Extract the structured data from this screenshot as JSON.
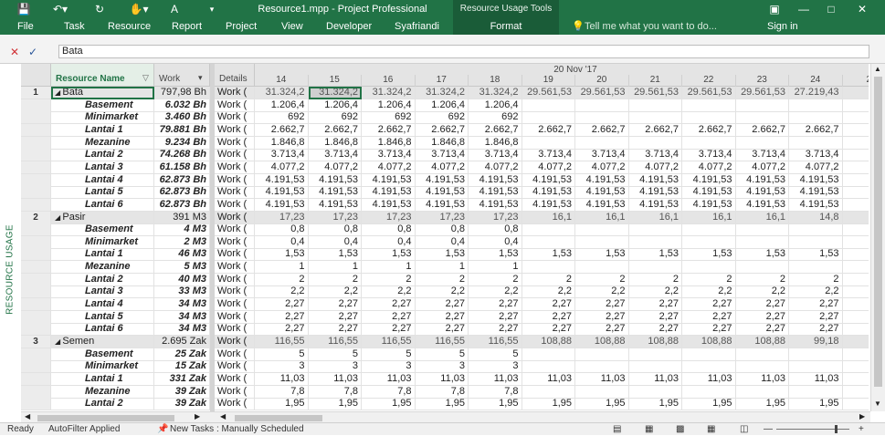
{
  "title": {
    "text": "Resource1.mpp - Project Professional",
    "context_group": "Resource Usage Tools",
    "user": "Sign in"
  },
  "ribbon": {
    "tabs": [
      "File",
      "Task",
      "Resource",
      "Report",
      "Project",
      "View",
      "Developer",
      "Syafriandi"
    ],
    "context_tab": "Format",
    "tell_me": "Tell me what you want to do..."
  },
  "entry": {
    "value": "Bata"
  },
  "view_label": "RESOURCE USAGE",
  "columns": {
    "name": "Resource Name",
    "work": "Work",
    "details": "Details",
    "week": "20 Nov '17",
    "days": [
      "14",
      "15",
      "16",
      "17",
      "18",
      "19",
      "20",
      "21",
      "22",
      "23",
      "24",
      "2"
    ]
  },
  "rows": [
    {
      "id": "1",
      "name": "Bata",
      "work": "797,98 Bh",
      "group": true,
      "d": "Work (",
      "vals": [
        "31.324,2",
        "31.324,2",
        "31.324,2",
        "31.324,2",
        "31.324,2",
        "29.561,53",
        "29.561,53",
        "29.561,53",
        "29.561,53",
        "29.561,53",
        "27.219,43",
        "27.2"
      ]
    },
    {
      "id": "",
      "name": "Basement",
      "work": "6.032 Bh",
      "group": false,
      "d": "Work (",
      "vals": [
        "1.206,4",
        "1.206,4",
        "1.206,4",
        "1.206,4",
        "1.206,4",
        "",
        "",
        "",
        "",
        "",
        "",
        ""
      ]
    },
    {
      "id": "",
      "name": "Minimarket",
      "work": "3.460 Bh",
      "group": false,
      "d": "Work (",
      "vals": [
        "692",
        "692",
        "692",
        "692",
        "692",
        "",
        "",
        "",
        "",
        "",
        "",
        ""
      ]
    },
    {
      "id": "",
      "name": "Lantai 1",
      "work": "79.881 Bh",
      "group": false,
      "d": "Work (",
      "vals": [
        "2.662,7",
        "2.662,7",
        "2.662,7",
        "2.662,7",
        "2.662,7",
        "2.662,7",
        "2.662,7",
        "2.662,7",
        "2.662,7",
        "2.662,7",
        "2.662,7",
        "2."
      ]
    },
    {
      "id": "",
      "name": "Mezanine",
      "work": "9.234 Bh",
      "group": false,
      "d": "Work (",
      "vals": [
        "1.846,8",
        "1.846,8",
        "1.846,8",
        "1.846,8",
        "1.846,8",
        "",
        "",
        "",
        "",
        "",
        "",
        ""
      ]
    },
    {
      "id": "",
      "name": "Lantai 2",
      "work": "74.268 Bh",
      "group": false,
      "d": "Work (",
      "vals": [
        "3.713,4",
        "3.713,4",
        "3.713,4",
        "3.713,4",
        "3.713,4",
        "3.713,4",
        "3.713,4",
        "3.713,4",
        "3.713,4",
        "3.713,4",
        "3.713,4",
        "3."
      ]
    },
    {
      "id": "",
      "name": "Lantai 3",
      "work": "61.158 Bh",
      "group": false,
      "d": "Work (",
      "vals": [
        "4.077,2",
        "4.077,2",
        "4.077,2",
        "4.077,2",
        "4.077,2",
        "4.077,2",
        "4.077,2",
        "4.077,2",
        "4.077,2",
        "4.077,2",
        "4.077,2",
        "4."
      ]
    },
    {
      "id": "",
      "name": "Lantai 4",
      "work": "62.873 Bh",
      "group": false,
      "d": "Work (",
      "vals": [
        "4.191,53",
        "4.191,53",
        "4.191,53",
        "4.191,53",
        "4.191,53",
        "4.191,53",
        "4.191,53",
        "4.191,53",
        "4.191,53",
        "4.191,53",
        "4.191,53",
        "4.1"
      ]
    },
    {
      "id": "",
      "name": "Lantai 5",
      "work": "62.873 Bh",
      "group": false,
      "d": "Work (",
      "vals": [
        "4.191,53",
        "4.191,53",
        "4.191,53",
        "4.191,53",
        "4.191,53",
        "4.191,53",
        "4.191,53",
        "4.191,53",
        "4.191,53",
        "4.191,53",
        "4.191,53",
        "4.1"
      ]
    },
    {
      "id": "",
      "name": "Lantai 6",
      "work": "62.873 Bh",
      "group": false,
      "d": "Work (",
      "vals": [
        "4.191,53",
        "4.191,53",
        "4.191,53",
        "4.191,53",
        "4.191,53",
        "4.191,53",
        "4.191,53",
        "4.191,53",
        "4.191,53",
        "4.191,53",
        "4.191,53",
        "4.1"
      ]
    },
    {
      "id": "2",
      "name": "Pasir",
      "work": "391 M3",
      "group": true,
      "d": "Work (",
      "vals": [
        "17,23",
        "17,23",
        "17,23",
        "17,23",
        "17,23",
        "16,1",
        "16,1",
        "16,1",
        "16,1",
        "16,1",
        "14,8",
        ""
      ]
    },
    {
      "id": "",
      "name": "Basement",
      "work": "4 M3",
      "group": false,
      "d": "Work (",
      "vals": [
        "0,8",
        "0,8",
        "0,8",
        "0,8",
        "0,8",
        "",
        "",
        "",
        "",
        "",
        "",
        ""
      ]
    },
    {
      "id": "",
      "name": "Minimarket",
      "work": "2 M3",
      "group": false,
      "d": "Work (",
      "vals": [
        "0,4",
        "0,4",
        "0,4",
        "0,4",
        "0,4",
        "",
        "",
        "",
        "",
        "",
        "",
        ""
      ]
    },
    {
      "id": "",
      "name": "Lantai 1",
      "work": "46 M3",
      "group": false,
      "d": "Work (",
      "vals": [
        "1,53",
        "1,53",
        "1,53",
        "1,53",
        "1,53",
        "1,53",
        "1,53",
        "1,53",
        "1,53",
        "1,53",
        "1,53",
        ""
      ]
    },
    {
      "id": "",
      "name": "Mezanine",
      "work": "5 M3",
      "group": false,
      "d": "Work (",
      "vals": [
        "1",
        "1",
        "1",
        "1",
        "1",
        "",
        "",
        "",
        "",
        "",
        "",
        ""
      ]
    },
    {
      "id": "",
      "name": "Lantai 2",
      "work": "40 M3",
      "group": false,
      "d": "Work (",
      "vals": [
        "2",
        "2",
        "2",
        "2",
        "2",
        "2",
        "2",
        "2",
        "2",
        "2",
        "2",
        ""
      ]
    },
    {
      "id": "",
      "name": "Lantai 3",
      "work": "33 M3",
      "group": false,
      "d": "Work (",
      "vals": [
        "2,2",
        "2,2",
        "2,2",
        "2,2",
        "2,2",
        "2,2",
        "2,2",
        "2,2",
        "2,2",
        "2,2",
        "2,2",
        ""
      ]
    },
    {
      "id": "",
      "name": "Lantai 4",
      "work": "34 M3",
      "group": false,
      "d": "Work (",
      "vals": [
        "2,27",
        "2,27",
        "2,27",
        "2,27",
        "2,27",
        "2,27",
        "2,27",
        "2,27",
        "2,27",
        "2,27",
        "2,27",
        ""
      ]
    },
    {
      "id": "",
      "name": "Lantai 5",
      "work": "34 M3",
      "group": false,
      "d": "Work (",
      "vals": [
        "2,27",
        "2,27",
        "2,27",
        "2,27",
        "2,27",
        "2,27",
        "2,27",
        "2,27",
        "2,27",
        "2,27",
        "2,27",
        ""
      ]
    },
    {
      "id": "",
      "name": "Lantai 6",
      "work": "34 M3",
      "group": false,
      "d": "Work (",
      "vals": [
        "2,27",
        "2,27",
        "2,27",
        "2,27",
        "2,27",
        "2,27",
        "2,27",
        "2,27",
        "2,27",
        "2,27",
        "2,27",
        ""
      ]
    },
    {
      "id": "3",
      "name": "Semen",
      "work": "2.695 Zak",
      "group": true,
      "d": "Work (",
      "vals": [
        "116,55",
        "116,55",
        "116,55",
        "116,55",
        "116,55",
        "108,88",
        "108,88",
        "108,88",
        "108,88",
        "108,88",
        "99,18",
        ""
      ]
    },
    {
      "id": "",
      "name": "Basement",
      "work": "25 Zak",
      "group": false,
      "d": "Work (",
      "vals": [
        "5",
        "5",
        "5",
        "5",
        "5",
        "",
        "",
        "",
        "",
        "",
        "",
        ""
      ]
    },
    {
      "id": "",
      "name": "Minimarket",
      "work": "15 Zak",
      "group": false,
      "d": "Work (",
      "vals": [
        "3",
        "3",
        "3",
        "3",
        "3",
        "",
        "",
        "",
        "",
        "",
        "",
        ""
      ]
    },
    {
      "id": "",
      "name": "Lantai 1",
      "work": "331 Zak",
      "group": false,
      "d": "Work (",
      "vals": [
        "11,03",
        "11,03",
        "11,03",
        "11,03",
        "11,03",
        "11,03",
        "11,03",
        "11,03",
        "11,03",
        "11,03",
        "11,03",
        ""
      ]
    },
    {
      "id": "",
      "name": "Mezanine",
      "work": "39 Zak",
      "group": false,
      "d": "Work (",
      "vals": [
        "7,8",
        "7,8",
        "7,8",
        "7,8",
        "7,8",
        "",
        "",
        "",
        "",
        "",
        "",
        ""
      ]
    },
    {
      "id": "",
      "name": "Lantai 2",
      "work": "39 Zak",
      "group": false,
      "d": "Work (",
      "vals": [
        "1,95",
        "1,95",
        "1,95",
        "1,95",
        "1,95",
        "1,95",
        "1,95",
        "1,95",
        "1,95",
        "1,95",
        "1,95",
        ""
      ]
    }
  ],
  "status": {
    "ready": "Ready",
    "filter": "AutoFilter Applied",
    "tasks": "New Tasks : Manually Scheduled"
  }
}
